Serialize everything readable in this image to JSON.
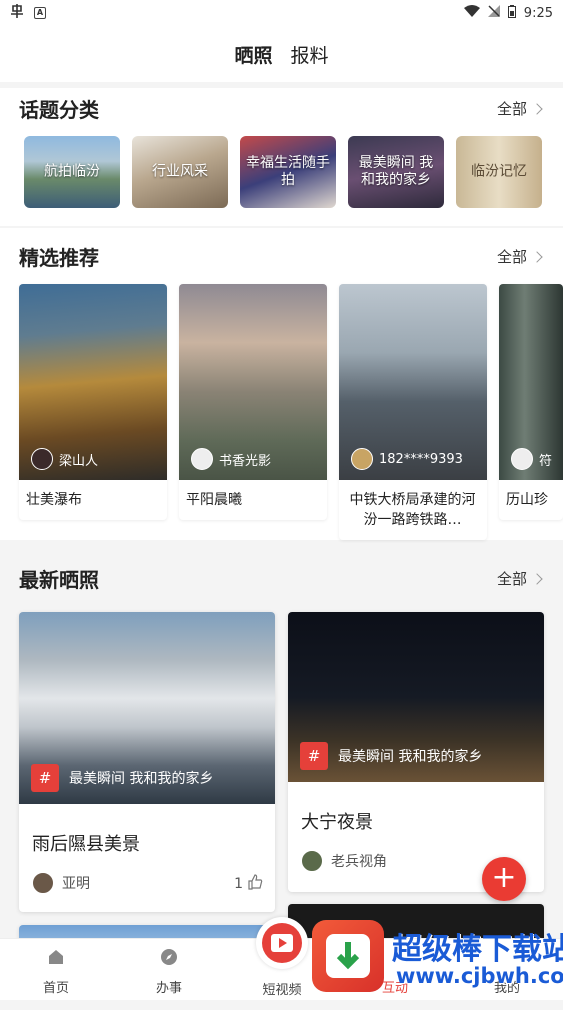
{
  "status_bar": {
    "time": "9:25"
  },
  "header": {
    "tabs": [
      "晒照",
      "报料"
    ]
  },
  "topics": {
    "title": "话题分类",
    "more": "全部",
    "items": [
      "航拍临汾",
      "行业风采",
      "幸福生活随手拍",
      "最美瞬间 我和我的家乡",
      "临汾记忆"
    ]
  },
  "featured": {
    "title": "精选推荐",
    "more": "全部",
    "items": [
      {
        "user": "梁山人",
        "caption": "壮美瀑布"
      },
      {
        "user": "书香光影",
        "caption": "平阳晨曦"
      },
      {
        "user": "182****9393",
        "caption": "中铁大桥局承建的河汾一路跨铁路…"
      },
      {
        "user": "符",
        "caption": "历山珍"
      }
    ]
  },
  "latest": {
    "title": "最新晒照",
    "more": "全部",
    "cards": [
      {
        "tag": "最美瞬间 我和我的家乡",
        "title": "雨后隰县美景",
        "user": "亚明",
        "likes": "1"
      },
      {
        "tag": "最美瞬间 我和我的家乡",
        "title": "大宁夜景",
        "user": "老兵视角",
        "likes": ""
      }
    ]
  },
  "fab": "+",
  "bottom_nav": [
    "首页",
    "办事",
    "短视频",
    "互动",
    "我的"
  ],
  "watermark": {
    "text": "超级棒下载站",
    "url": "www.cjbwh.com"
  },
  "colors": {
    "accent": "#e5403a"
  }
}
